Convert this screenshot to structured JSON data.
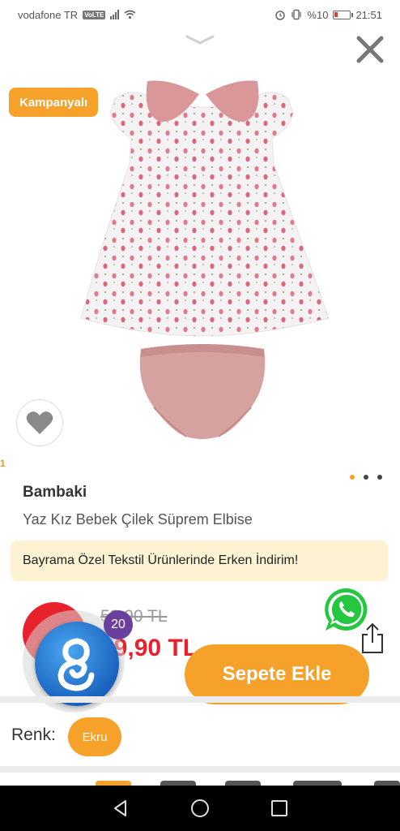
{
  "status_bar": {
    "carrier": "vodafone TR",
    "volte": "VoLTE",
    "battery": "%10",
    "time": "21:51"
  },
  "product": {
    "campaign_badge": "Kampanyalı",
    "brand": "Bambaki",
    "name": "Yaz Kız Bebek Çilek Süprem Elbise",
    "promo_text": "Bayrama Özel Tekstil Ürünlerinde Erken İndirim!",
    "old_price": "59,90 TL",
    "new_price": "49,90 TL",
    "image_count": 3,
    "image_active_index": 0
  },
  "assistant": {
    "count": "20"
  },
  "actions": {
    "cart_label": "Sepete Ekle"
  },
  "color": {
    "label": "Renk:",
    "selected": "Ekru"
  },
  "icons": {
    "collapse": "chevron-down-icon",
    "close": "close-icon",
    "favorite": "heart-icon",
    "whatsapp": "whatsapp-icon",
    "share": "share-icon",
    "nav_back": "back-icon",
    "nav_home": "home-icon",
    "nav_recents": "recents-icon"
  },
  "colors": {
    "accent": "#f6a12a",
    "price_red": "#e8222d",
    "promo_bg": "#fdf2d2",
    "whatsapp_green": "#25c640",
    "assistant_badge": "#6a3f9e"
  }
}
